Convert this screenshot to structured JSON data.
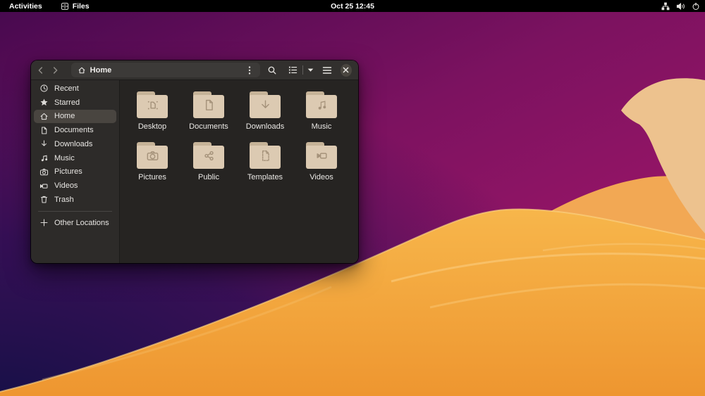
{
  "topbar": {
    "activities_label": "Activities",
    "app_button": {
      "label": "Files",
      "icon": "files-app-icon"
    },
    "clock": "Oct 25 12:45",
    "status_icons": [
      "network-icon",
      "volume-icon",
      "power-icon"
    ]
  },
  "window": {
    "headerbar": {
      "back_icon": "back-arrow-icon",
      "forward_icon": "forward-arrow-icon",
      "location": {
        "icon": "home-icon",
        "label": "Home",
        "more_icon": "kebab-menu-icon"
      },
      "search_icon": "search-icon",
      "view_toggle": {
        "view_icon": "list-view-icon",
        "caret_icon": "chevron-down-icon"
      },
      "menu_icon": "hamburger-menu-icon",
      "close_icon": "close-icon"
    },
    "sidebar": {
      "items": [
        {
          "id": "recent",
          "label": "Recent",
          "icon": "clock-icon",
          "selected": false
        },
        {
          "id": "starred",
          "label": "Starred",
          "icon": "star-icon",
          "selected": false
        },
        {
          "id": "home",
          "label": "Home",
          "icon": "home-icon",
          "selected": true
        },
        {
          "id": "documents",
          "label": "Documents",
          "icon": "document-icon",
          "selected": false
        },
        {
          "id": "downloads",
          "label": "Downloads",
          "icon": "download-icon",
          "selected": false
        },
        {
          "id": "music",
          "label": "Music",
          "icon": "music-note-icon",
          "selected": false
        },
        {
          "id": "pictures",
          "label": "Pictures",
          "icon": "camera-icon",
          "selected": false
        },
        {
          "id": "videos",
          "label": "Videos",
          "icon": "video-camera-icon",
          "selected": false
        },
        {
          "id": "trash",
          "label": "Trash",
          "icon": "trash-icon",
          "selected": false
        }
      ],
      "other_locations": {
        "label": "Other Locations",
        "icon": "plus-icon"
      }
    },
    "grid": {
      "folders": [
        {
          "label": "Desktop",
          "emblem": "desktop"
        },
        {
          "label": "Documents",
          "emblem": "document"
        },
        {
          "label": "Downloads",
          "emblem": "download"
        },
        {
          "label": "Music",
          "emblem": "music"
        },
        {
          "label": "Pictures",
          "emblem": "camera"
        },
        {
          "label": "Public",
          "emblem": "share"
        },
        {
          "label": "Templates",
          "emblem": "template"
        },
        {
          "label": "Videos",
          "emblem": "video"
        }
      ]
    }
  },
  "colors": {
    "folder_body": "#dccab2",
    "folder_tab": "#c6b398",
    "headerbar": "#32302e",
    "sidebar": "#2d2b29",
    "content": "#262422",
    "wallpaper_purple": "#8e1763",
    "wallpaper_navy": "#171046",
    "dune_orange": "#f3a63f",
    "petal_peach": "#edc28e"
  }
}
